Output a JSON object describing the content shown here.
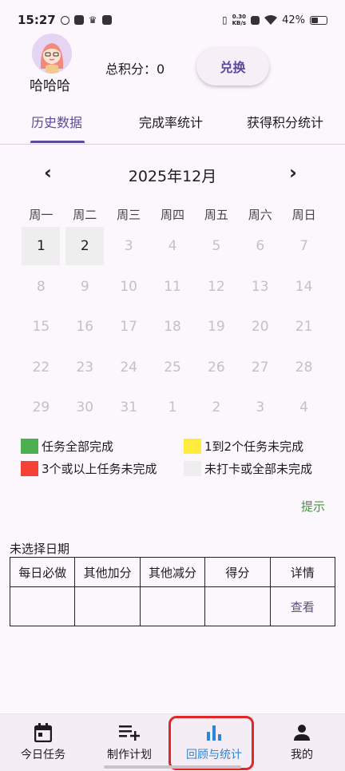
{
  "status_bar": {
    "time": "15:27",
    "net_speed_value": "0.30",
    "net_speed_unit": "KB/s",
    "battery": "42%",
    "battery_level": 0.42
  },
  "profile": {
    "username": "哈哈哈",
    "points": "总积分：0",
    "exchange_label": "兑换"
  },
  "tabs": [
    {
      "label": "历史数据",
      "active": true
    },
    {
      "label": "完成率统计",
      "active": false
    },
    {
      "label": "获得积分统计",
      "active": false
    }
  ],
  "calendar": {
    "prev": "‹",
    "next": "›",
    "month_title": "2025年12月",
    "weekdays": [
      "周一",
      "周二",
      "周三",
      "周四",
      "周五",
      "周六",
      "周日"
    ],
    "days": [
      "1",
      "2",
      "3",
      "4",
      "5",
      "6",
      "7",
      "8",
      "9",
      "10",
      "11",
      "12",
      "13",
      "14",
      "15",
      "16",
      "17",
      "18",
      "19",
      "20",
      "21",
      "22",
      "23",
      "24",
      "25",
      "26",
      "27",
      "28",
      "29",
      "30",
      "31",
      "1",
      "2",
      "3",
      "4"
    ],
    "active_count": 2
  },
  "legend": [
    {
      "label": "任务全部完成",
      "color": "#4caf50"
    },
    {
      "label": "1到2个任务未完成",
      "color": "#ffeb3b"
    },
    {
      "label": "3个或以上任务未完成",
      "color": "#f44336"
    },
    {
      "label": "未打卡或全部未完成",
      "color": "#eeeeee"
    }
  ],
  "hint_label": "提示",
  "no_date_label": "未选择日期",
  "table": {
    "headers": [
      "每日必做",
      "其他加分",
      "其他减分",
      "得分",
      "详情"
    ],
    "row": [
      "",
      "",
      "",
      "",
      "查看"
    ]
  },
  "bottom_nav": [
    {
      "label": "今日任务",
      "icon": "calendar-icon",
      "active": false
    },
    {
      "label": "制作计划",
      "icon": "playlist-add-icon",
      "active": false
    },
    {
      "label": "回顾与统计",
      "icon": "bar-chart-icon",
      "active": true
    },
    {
      "label": "我的",
      "icon": "person-icon",
      "active": false
    }
  ]
}
